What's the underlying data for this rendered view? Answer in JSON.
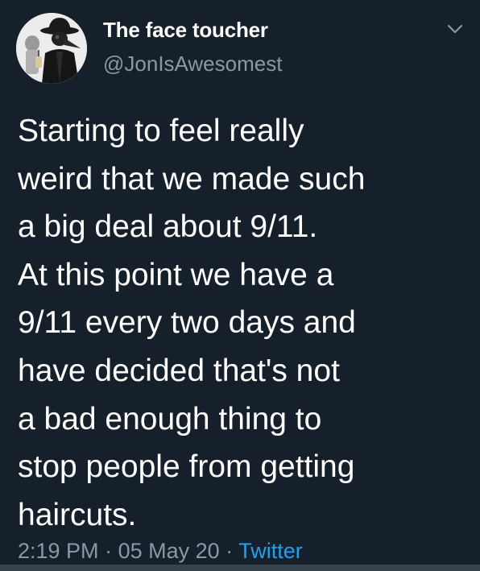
{
  "user": {
    "display_name": "The face toucher",
    "handle": "@JonIsAwesomest",
    "avatar_icon": "profile-photo-icon"
  },
  "tweet": {
    "lines": [
      "Starting to feel really",
      "weird that we made such",
      "a big deal about 9/11.",
      "At this point we have a",
      "9/11 every two days and",
      "have decided that's not",
      "a bad enough thing to",
      "stop people from getting",
      "haircuts."
    ],
    "time": "2:19 PM",
    "separator": "·",
    "date": "05 May 20",
    "source": "Twitter"
  },
  "colors": {
    "background": "#15202b",
    "text": "#ffffff",
    "secondary": "#8899a6",
    "link": "#1da1f2"
  }
}
